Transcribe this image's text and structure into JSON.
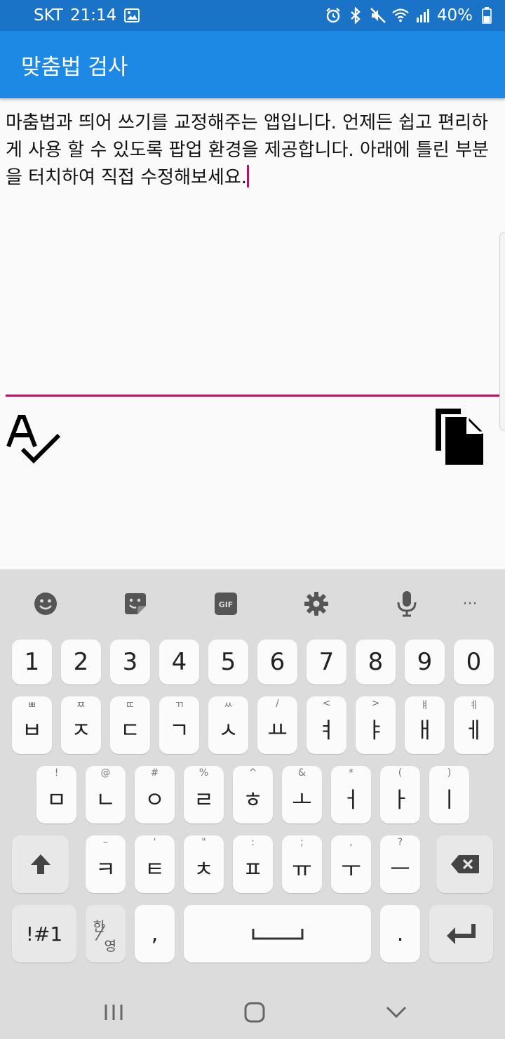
{
  "status_bar": {
    "carrier": "SKT",
    "time": "21:14",
    "battery": "40%",
    "icons": [
      "image-icon",
      "alarm-icon",
      "bluetooth-icon",
      "mute-icon",
      "wifi-icon",
      "signal-icon",
      "battery-icon"
    ]
  },
  "app_bar": {
    "title": "맞춤법 검사"
  },
  "editor": {
    "text": "마춤법과 띄어 쓰기를 교정해주는 앱입니다. 언제든 쉽고 편리하게 사용 할 수 있도록 팝업 환경을 제공합니다. 아래에 틀린 부분을 터치하여 직접 수정해보세요.",
    "underline_color": "#b0185a"
  },
  "actions": {
    "spellcheck_icon": "spellcheck-icon",
    "copy_icon": "copy-icon"
  },
  "keyboard": {
    "toolbar": [
      "emoji-icon",
      "sticker-icon",
      "gif-icon",
      "settings-icon",
      "mic-icon",
      "more-icon"
    ],
    "gif_label": "GIF",
    "more_label": "···",
    "row_numbers": [
      {
        "main": "1"
      },
      {
        "main": "2"
      },
      {
        "main": "3"
      },
      {
        "main": "4"
      },
      {
        "main": "5"
      },
      {
        "main": "6"
      },
      {
        "main": "7"
      },
      {
        "main": "8"
      },
      {
        "main": "9"
      },
      {
        "main": "0"
      }
    ],
    "row1": [
      {
        "sub": "ㅃ",
        "main": "ㅂ"
      },
      {
        "sub": "ㅉ",
        "main": "ㅈ"
      },
      {
        "sub": "ㄸ",
        "main": "ㄷ"
      },
      {
        "sub": "ㄲ",
        "main": "ㄱ"
      },
      {
        "sub": "ㅆ",
        "main": "ㅅ"
      },
      {
        "sub": "/",
        "main": "ㅛ"
      },
      {
        "sub": "<",
        "main": "ㅕ"
      },
      {
        "sub": ">",
        "main": "ㅑ"
      },
      {
        "sub": "ㅒ",
        "main": "ㅐ"
      },
      {
        "sub": "ㅖ",
        "main": "ㅔ"
      }
    ],
    "row2": [
      {
        "sub": "!",
        "main": "ㅁ"
      },
      {
        "sub": "@",
        "main": "ㄴ"
      },
      {
        "sub": "#",
        "main": "ㅇ"
      },
      {
        "sub": "%",
        "main": "ㄹ"
      },
      {
        "sub": "^",
        "main": "ㅎ"
      },
      {
        "sub": "&",
        "main": "ㅗ"
      },
      {
        "sub": "*",
        "main": "ㅓ"
      },
      {
        "sub": "(",
        "main": "ㅏ"
      },
      {
        "sub": ")",
        "main": "ㅣ"
      }
    ],
    "row3": [
      {
        "sub": "–",
        "main": "ㅋ"
      },
      {
        "sub": "'",
        "main": "ㅌ"
      },
      {
        "sub": "\"",
        "main": "ㅊ"
      },
      {
        "sub": ":",
        "main": "ㅍ"
      },
      {
        "sub": ";",
        "main": "ㅠ"
      },
      {
        "sub": ",",
        "main": "ㅜ"
      },
      {
        "sub": "?",
        "main": "ㅡ"
      }
    ],
    "symbols_label": "!#1",
    "han_label": "한",
    "yeong_label": "영",
    "slash_label": "⁄",
    "comma_label": ",",
    "period_label": ".",
    "shift_icon": "shift-icon",
    "backspace_icon": "backspace-icon",
    "enter_icon": "enter-icon",
    "space_icon": "space-icon"
  },
  "nav_bar": {
    "icons": [
      "recents-icon",
      "home-icon",
      "back-icon"
    ]
  }
}
